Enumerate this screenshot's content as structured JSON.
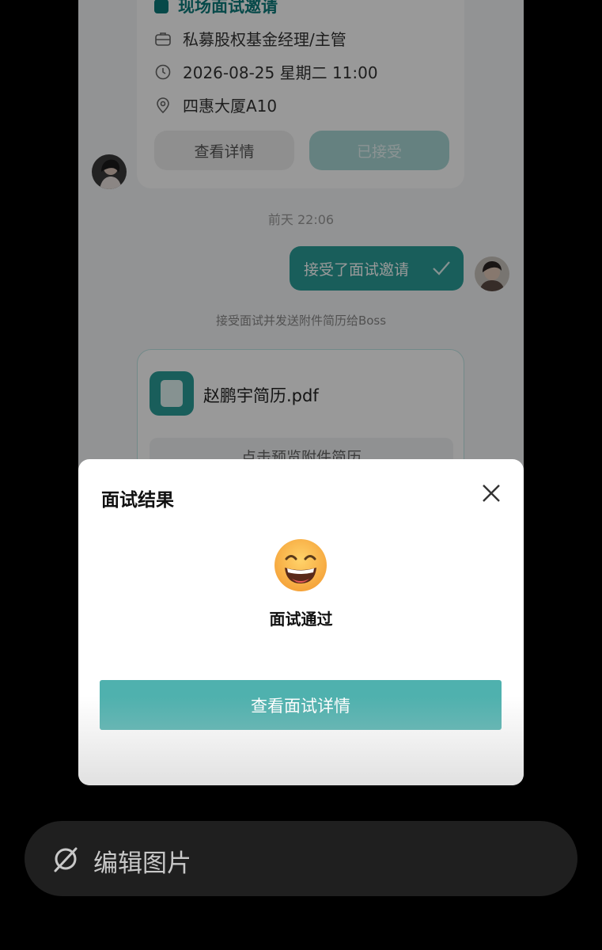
{
  "invite_card": {
    "title": "现场面试邀请",
    "position": "私募股权基金经理/主管",
    "datetime": "2026-08-25 星期二 11:00",
    "location": "四惠大厦A10",
    "detail_button": "查看详情",
    "accepted_button": "已接受"
  },
  "chat": {
    "timestamp": "前天 22:06",
    "bubble_text": "接受了面试邀请",
    "system_note": "接受面试并发送附件简历给Boss"
  },
  "attachment": {
    "file_name": "赵鹏宇简历.pdf",
    "preview_button": "点击预览附件简历"
  },
  "modal": {
    "title": "面试结果",
    "result": "面试通过",
    "primary_button": "查看面试详情"
  },
  "edit_bar": {
    "label": "编辑图片"
  },
  "colors": {
    "accent": "#2a9d98",
    "button": "#4fb1ae",
    "background": "#000000"
  }
}
